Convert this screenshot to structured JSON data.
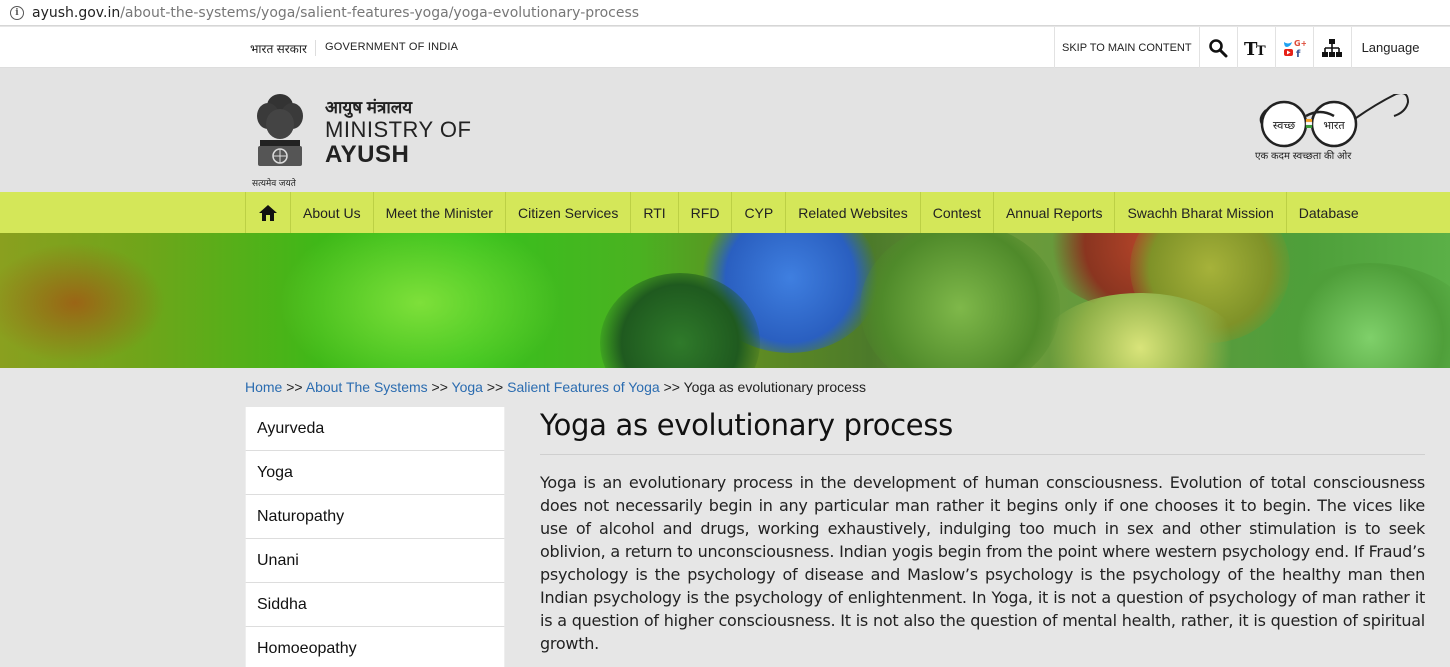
{
  "browser": {
    "url_domain": "ayush.gov.in",
    "url_path": "/about-the-systems/yoga/salient-features-yoga/yoga-evolutionary-process"
  },
  "gov_bar": {
    "bharat_sarkar": "भारत सरकार",
    "government": "GOVERNMENT OF INDIA",
    "skip": "SKIP TO MAIN CONTENT",
    "language": "Language"
  },
  "header": {
    "ministry_hindi": "आयुष मंत्रालय",
    "ministry_line1": "MINISTRY OF",
    "ministry_line2": "AYUSH",
    "emblem_motto": "सत्यमेव जयते",
    "swachh_left": "स्वच्छ",
    "swachh_right": "भारत",
    "swachh_tagline": "एक कदम स्वच्छता की ओर"
  },
  "nav": {
    "items": [
      {
        "label": "About Us"
      },
      {
        "label": "Meet the Minister"
      },
      {
        "label": "Citizen Services"
      },
      {
        "label": "RTI"
      },
      {
        "label": "RFD"
      },
      {
        "label": "CYP"
      },
      {
        "label": "Related Websites"
      },
      {
        "label": "Contest"
      },
      {
        "label": "Annual Reports"
      },
      {
        "label": "Swachh Bharat Mission"
      },
      {
        "label": "Database"
      }
    ]
  },
  "breadcrumb": {
    "items": [
      "Home",
      "About The Systems",
      "Yoga",
      "Salient Features of Yoga"
    ],
    "separator": ">>",
    "current": "Yoga as evolutionary process"
  },
  "sidebar": {
    "items": [
      {
        "label": "Ayurveda"
      },
      {
        "label": "Yoga"
      },
      {
        "label": "Naturopathy"
      },
      {
        "label": "Unani"
      },
      {
        "label": "Siddha"
      },
      {
        "label": "Homoeopathy"
      }
    ]
  },
  "content": {
    "title": "Yoga as evolutionary process",
    "body": "Yoga is an evolutionary process in the development of human consciousness. Evolution of total consciousness does not necessarily begin in any particular man rather it begins only if one chooses it to begin. The vices like use of alcohol and drugs, working exhaustively, indulging too much in sex and other stimulation is to seek oblivion, a return to unconsciousness. Indian yogis begin from the point where western psychology end. If Fraud’s psychology is the psychology of disease and Maslow’s psychology is the psychology of the healthy man then Indian psychology is the psychology of enlightenment. In Yoga, it is not a question of psychology of man rather it is a question of higher consciousness. It is not also the question of mental health, rather, it is question of spiritual growth."
  },
  "colors": {
    "nav_bg": "#d4e759",
    "link": "#2b6cb0",
    "page_bg": "#e6e6e6"
  }
}
